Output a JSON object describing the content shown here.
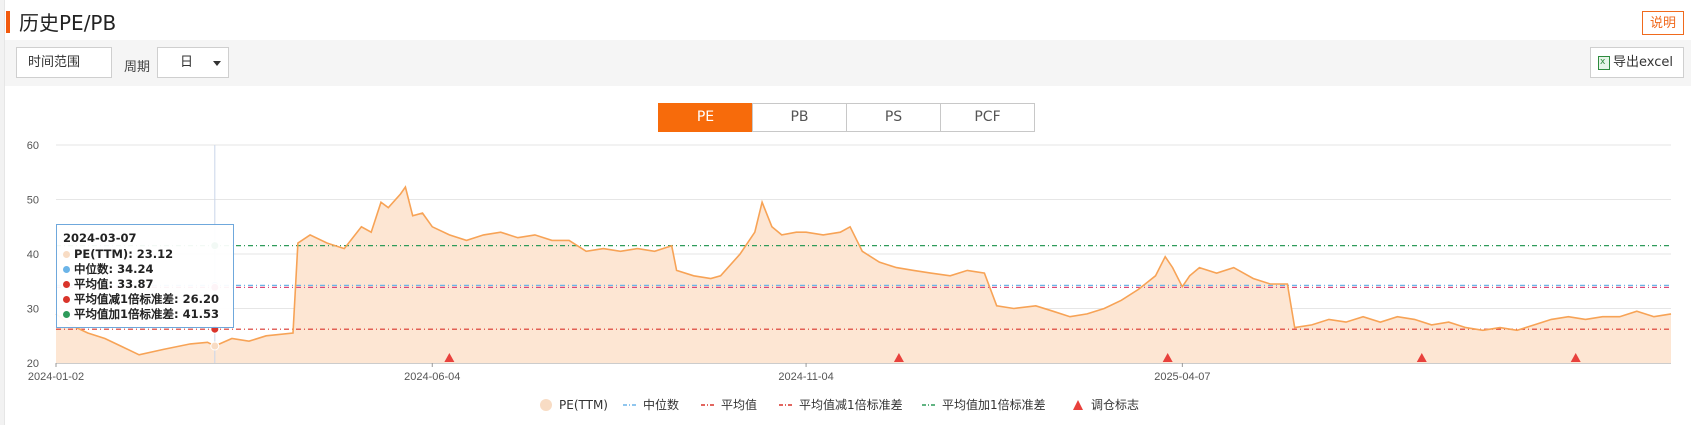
{
  "header": {
    "title": "历史PE/PB",
    "explain_label": "说明"
  },
  "toolbar": {
    "range_label": "时间范围",
    "period_label": "周期",
    "period_value": "日",
    "export_label": "导出excel"
  },
  "tabs": [
    {
      "label": "PE",
      "active": true
    },
    {
      "label": "PB",
      "active": false
    },
    {
      "label": "PS",
      "active": false
    },
    {
      "label": "PCF",
      "active": false
    }
  ],
  "tooltip": {
    "date": "2024-03-07",
    "rows": [
      {
        "label": "PE(TTM): 23.12",
        "color": "#f8dcc4"
      },
      {
        "label": "中位数: 34.24",
        "color": "#6bb4e8"
      },
      {
        "label": "平均值: 33.87",
        "color": "#d9342b"
      },
      {
        "label": "平均值减1倍标准差: 26.20",
        "color": "#d9342b"
      },
      {
        "label": "平均值加1倍标准差: 41.53",
        "color": "#2e9b5a"
      }
    ]
  },
  "colors": {
    "accent": "#f76b0b",
    "pe_line": "#f7a356",
    "pe_fill": "#fde6d3",
    "median": "#6bb4e8",
    "mean": "#d94a7a",
    "mean_minus_sd": "#d9342b",
    "mean_plus_sd": "#2e9b5a",
    "rebalance_marker": "#e8413c"
  },
  "chart_data": {
    "type": "line",
    "ylim": [
      20,
      60
    ],
    "yticks": [
      20,
      30,
      40,
      50,
      60
    ],
    "xticks": [
      "2024-01-02",
      "2024-06-04",
      "2024-11-04",
      "2025-04-07"
    ],
    "grid": true,
    "legend_position": "bottom",
    "series": [
      {
        "name": "PE(TTM)",
        "kind": "area",
        "points": [
          [
            "2024-01-02",
            29.0
          ],
          [
            "2024-01-08",
            27.0
          ],
          [
            "2024-01-15",
            25.5
          ],
          [
            "2024-01-22",
            24.5
          ],
          [
            "2024-01-29",
            23.0
          ],
          [
            "2024-02-05",
            21.5
          ],
          [
            "2024-02-15",
            22.5
          ],
          [
            "2024-02-26",
            23.5
          ],
          [
            "2024-03-04",
            23.8
          ],
          [
            "2024-03-07",
            23.12
          ],
          [
            "2024-03-14",
            24.5
          ],
          [
            "2024-03-21",
            24.0
          ],
          [
            "2024-03-28",
            25.0
          ],
          [
            "2024-04-08",
            25.5
          ],
          [
            "2024-04-10",
            42.0
          ],
          [
            "2024-04-15",
            43.5
          ],
          [
            "2024-04-22",
            42.0
          ],
          [
            "2024-04-29",
            41.0
          ],
          [
            "2024-05-06",
            45.0
          ],
          [
            "2024-05-10",
            44.0
          ],
          [
            "2024-05-14",
            49.5
          ],
          [
            "2024-05-17",
            48.5
          ],
          [
            "2024-05-22",
            51.0
          ],
          [
            "2024-05-24",
            52.3
          ],
          [
            "2024-05-27",
            47.0
          ],
          [
            "2024-05-31",
            47.5
          ],
          [
            "2024-06-04",
            45.0
          ],
          [
            "2024-06-11",
            43.5
          ],
          [
            "2024-06-18",
            42.5
          ],
          [
            "2024-06-25",
            43.5
          ],
          [
            "2024-07-02",
            44.0
          ],
          [
            "2024-07-09",
            43.0
          ],
          [
            "2024-07-16",
            43.5
          ],
          [
            "2024-07-23",
            42.5
          ],
          [
            "2024-07-30",
            42.5
          ],
          [
            "2024-08-06",
            40.5
          ],
          [
            "2024-08-13",
            41.0
          ],
          [
            "2024-08-20",
            40.5
          ],
          [
            "2024-08-27",
            41.0
          ],
          [
            "2024-09-03",
            40.5
          ],
          [
            "2024-09-10",
            41.5
          ],
          [
            "2024-09-12",
            37.0
          ],
          [
            "2024-09-19",
            36.0
          ],
          [
            "2024-09-26",
            35.5
          ],
          [
            "2024-09-30",
            36.0
          ],
          [
            "2024-10-08",
            40.0
          ],
          [
            "2024-10-14",
            44.0
          ],
          [
            "2024-10-17",
            49.5
          ],
          [
            "2024-10-21",
            45.0
          ],
          [
            "2024-10-25",
            43.5
          ],
          [
            "2024-10-31",
            44.0
          ],
          [
            "2024-11-04",
            44.0
          ],
          [
            "2024-11-11",
            43.5
          ],
          [
            "2024-11-18",
            44.0
          ],
          [
            "2024-11-22",
            45.0
          ],
          [
            "2024-11-27",
            40.5
          ],
          [
            "2024-12-04",
            38.5
          ],
          [
            "2024-12-11",
            37.5
          ],
          [
            "2024-12-18",
            37.0
          ],
          [
            "2024-12-25",
            36.5
          ],
          [
            "2025-01-02",
            36.0
          ],
          [
            "2025-01-09",
            37.0
          ],
          [
            "2025-01-16",
            36.5
          ],
          [
            "2025-01-21",
            30.5
          ],
          [
            "2025-01-28",
            30.0
          ],
          [
            "2025-02-06",
            30.5
          ],
          [
            "2025-02-13",
            29.5
          ],
          [
            "2025-02-20",
            28.5
          ],
          [
            "2025-02-27",
            29.0
          ],
          [
            "2025-03-06",
            30.0
          ],
          [
            "2025-03-13",
            31.5
          ],
          [
            "2025-03-20",
            33.5
          ],
          [
            "2025-03-27",
            36.0
          ],
          [
            "2025-03-31",
            39.5
          ],
          [
            "2025-04-03",
            37.5
          ],
          [
            "2025-04-07",
            34.0
          ],
          [
            "2025-04-10",
            36.0
          ],
          [
            "2025-04-14",
            37.5
          ],
          [
            "2025-04-21",
            36.5
          ],
          [
            "2025-04-28",
            37.5
          ],
          [
            "2025-05-06",
            35.5
          ],
          [
            "2025-05-13",
            34.5
          ],
          [
            "2025-05-20",
            34.5
          ],
          [
            "2025-05-23",
            26.5
          ],
          [
            "2025-05-30",
            27.0
          ],
          [
            "2025-06-06",
            28.0
          ],
          [
            "2025-06-13",
            27.5
          ],
          [
            "2025-06-20",
            28.5
          ],
          [
            "2025-06-27",
            27.5
          ],
          [
            "2025-07-04",
            28.5
          ],
          [
            "2025-07-11",
            28.0
          ],
          [
            "2025-07-18",
            27.0
          ],
          [
            "2025-07-25",
            27.5
          ],
          [
            "2025-08-01",
            26.5
          ],
          [
            "2025-08-08",
            26.0
          ],
          [
            "2025-08-15",
            26.5
          ],
          [
            "2025-08-22",
            26.0
          ],
          [
            "2025-08-29",
            27.0
          ],
          [
            "2025-09-05",
            28.0
          ],
          [
            "2025-09-12",
            28.5
          ],
          [
            "2025-09-19",
            28.0
          ],
          [
            "2025-09-26",
            28.5
          ],
          [
            "2025-10-03",
            28.5
          ],
          [
            "2025-10-10",
            29.5
          ],
          [
            "2025-10-17",
            28.5
          ],
          [
            "2025-10-24",
            29.0
          ]
        ]
      },
      {
        "name": "中位数",
        "kind": "hline",
        "value": 34.24
      },
      {
        "name": "平均值",
        "kind": "hline",
        "value": 33.87
      },
      {
        "name": "平均值减1倍标准差",
        "kind": "hline",
        "value": 26.2
      },
      {
        "name": "平均值加1倍标准差",
        "kind": "hline",
        "value": 41.53
      },
      {
        "name": "调仓标志",
        "kind": "markers",
        "dates": [
          "2024-06-11",
          "2024-12-12",
          "2025-04-01",
          "2025-07-14",
          "2025-09-15"
        ]
      }
    ]
  }
}
